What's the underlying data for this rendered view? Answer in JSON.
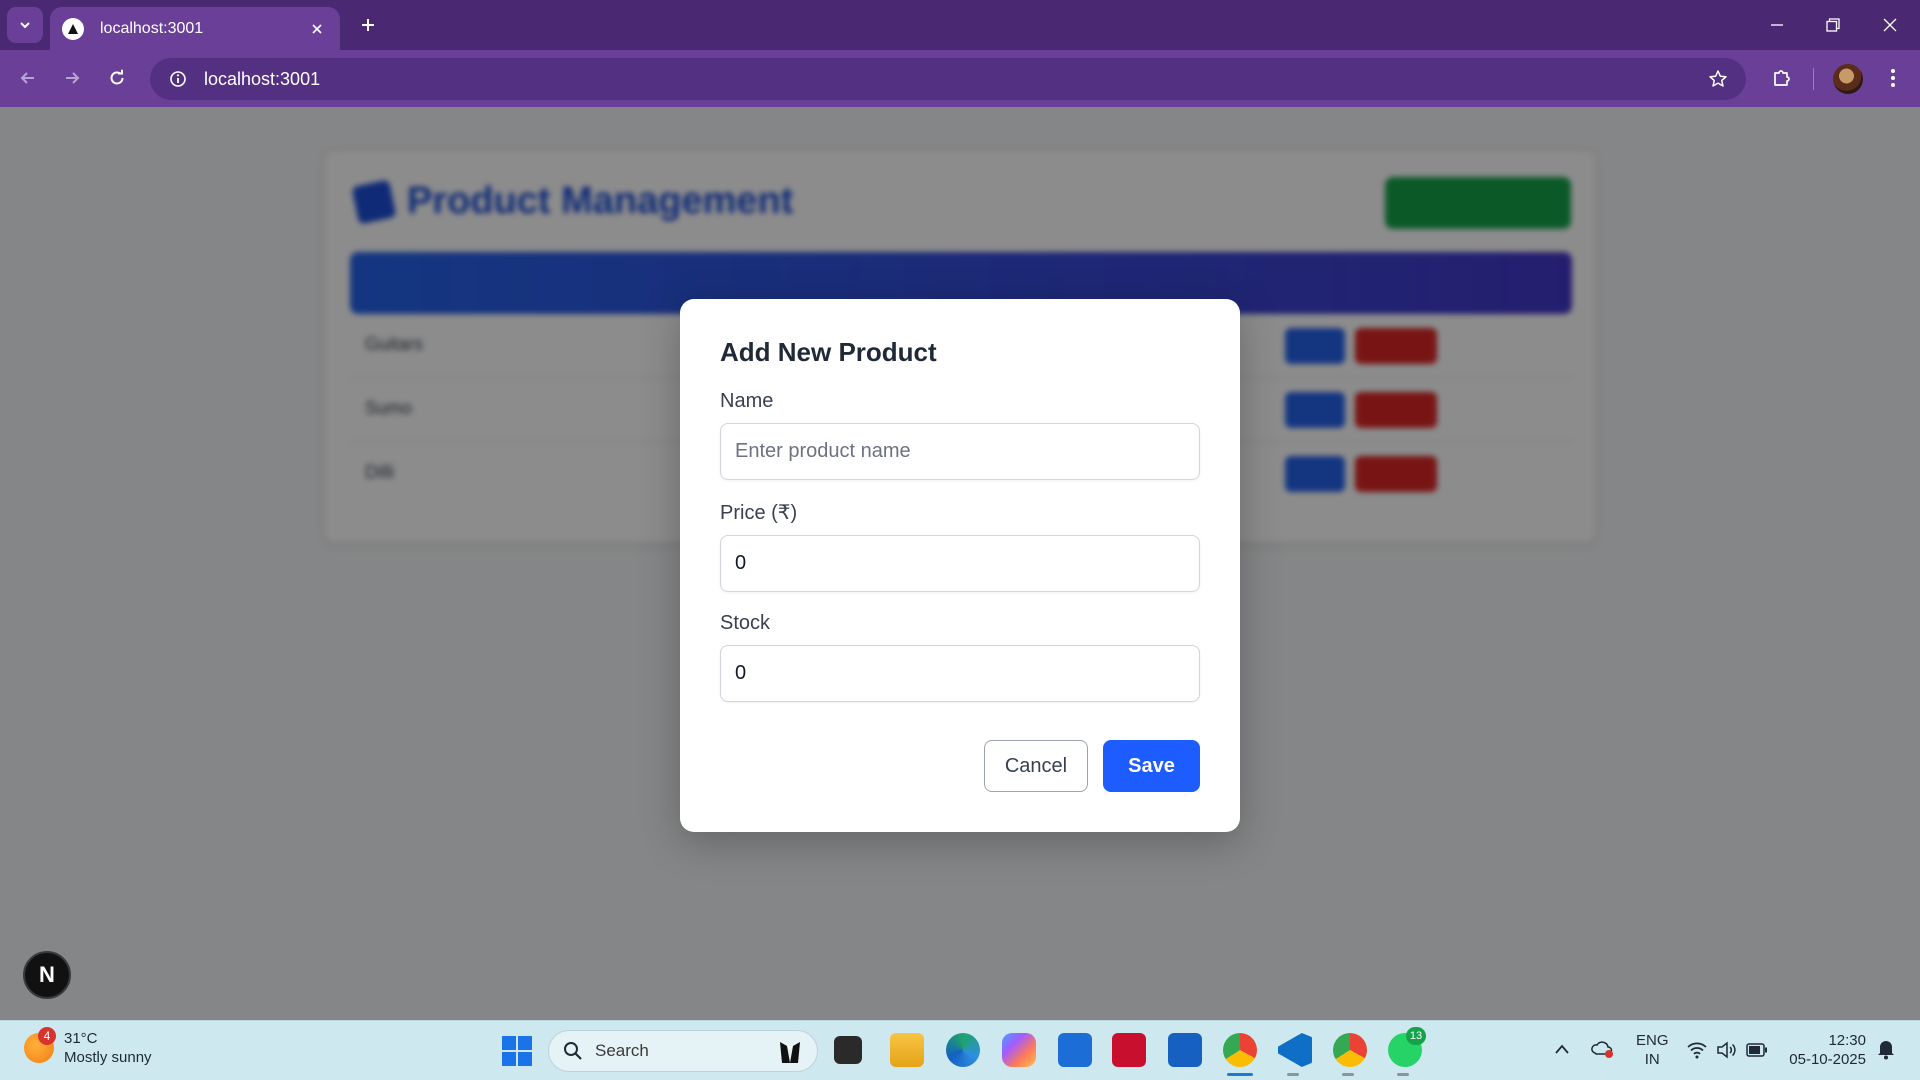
{
  "browser": {
    "tab_title": "localhost:3001",
    "url": "localhost:3001"
  },
  "background_app": {
    "title": "Product Management",
    "add_button": "",
    "table_headers": [
      "",
      "",
      "",
      ""
    ],
    "rows": [
      {
        "name": "Guitars"
      },
      {
        "name": "Sumo"
      },
      {
        "name": "Dilli"
      }
    ]
  },
  "modal": {
    "title": "Add New Product",
    "name_label": "Name",
    "name_placeholder": "Enter product name",
    "name_value": "",
    "price_label": "Price (₹)",
    "price_value": "0",
    "stock_label": "Stock",
    "stock_value": "0",
    "cancel_label": "Cancel",
    "save_label": "Save"
  },
  "next_badge": "N",
  "taskbar": {
    "weather_temp": "31°C",
    "weather_desc": "Mostly sunny",
    "weather_badge": "4",
    "search_label": "Search",
    "whatsapp_badge": "13",
    "lang_line1": "ENG",
    "lang_line2": "IN",
    "time": "12:30",
    "date": "05-10-2025"
  },
  "colors": {
    "brand_purple": "#6a3f98",
    "primary_blue": "#1d5cff",
    "success_green": "#16a34a",
    "danger_red": "#dc2626"
  }
}
